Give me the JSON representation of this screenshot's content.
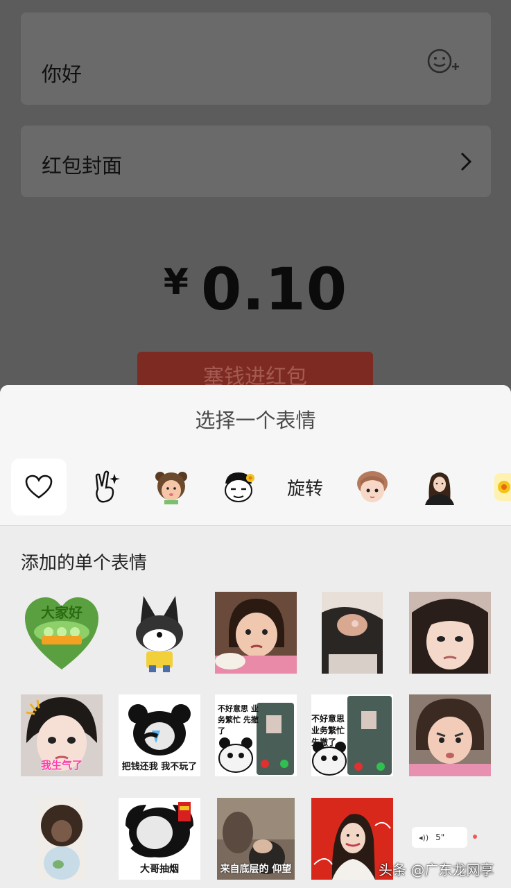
{
  "background": {
    "greeting": "你好",
    "cover_label": "红包封面",
    "amount_currency": "¥",
    "amount_value": "0.10",
    "send_button": "塞钱进红包"
  },
  "sheet": {
    "title": "选择一个表情",
    "packs": [
      {
        "icon": "heart-icon",
        "label": ""
      },
      {
        "icon": "victory-hand-icon",
        "label": ""
      },
      {
        "icon": "bear-hat-baby-icon",
        "label": ""
      },
      {
        "icon": "meme-face-icon",
        "label": ""
      },
      {
        "icon": "",
        "label": "旋转"
      },
      {
        "icon": "cartoon-girl-icon",
        "label": ""
      },
      {
        "icon": "woman-portrait-icon",
        "label": ""
      },
      {
        "icon": "flower-sticker-icon",
        "label": ""
      }
    ],
    "section_title": "添加的单个表情",
    "stickers": [
      {
        "caption": "大家好"
      },
      {
        "caption": ""
      },
      {
        "caption": ""
      },
      {
        "caption": ""
      },
      {
        "caption": ""
      },
      {
        "caption": "我生气了"
      },
      {
        "caption": "把钱还我 我不玩了"
      },
      {
        "caption": "不好意思 业务繁忙 先撤了"
      },
      {
        "caption": "不好意思 业务繁忙 先撤了"
      },
      {
        "caption": ""
      },
      {
        "caption": ""
      },
      {
        "caption": "大哥抽烟"
      },
      {
        "caption": "来自底层的 仰望"
      },
      {
        "caption": ""
      }
    ]
  },
  "overlay": {
    "voice_duration": "5\"",
    "watermark": "头条 @广东龙网享"
  },
  "colors": {
    "dim_background": "#5c5c5c",
    "sheet_background": "#ededed",
    "red_button": "#7d2a22"
  }
}
